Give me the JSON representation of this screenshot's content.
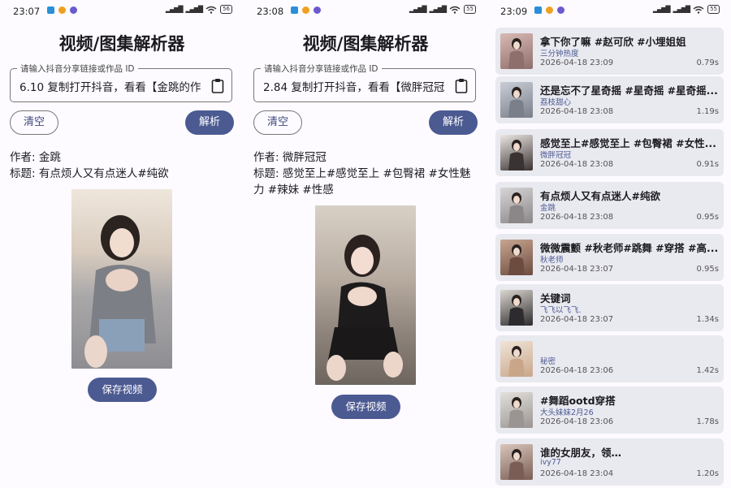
{
  "screen1": {
    "status_time": "23:07",
    "status_signal": "⁵⁶ᴵᴵˡ",
    "status_battery": "56",
    "title": "视频/图集解析器",
    "input_label": "请输入抖音分享链接或作品 ID",
    "input_value": "6.10 复制打开抖音，看看【金跳的作",
    "clear_label": "清空",
    "parse_label": "解析",
    "author": "作者: 金跳",
    "caption": "标题: 有点烦人又有点迷人#纯欲",
    "save_label": "保存视频"
  },
  "screen2": {
    "status_time": "23:08",
    "status_battery": "55",
    "title": "视频/图集解析器",
    "input_label": "请输入抖音分享链接或作品 ID",
    "input_value": "2.84 复制打开抖音，看看【微胖冠冠",
    "clear_label": "清空",
    "parse_label": "解析",
    "author": "作者: 微胖冠冠",
    "caption": "标题: 感觉至上#感觉至上 #包臀裙 #女性魅力 #辣妹 #性感",
    "save_label": "保存视频"
  },
  "screen3": {
    "status_time": "23:09",
    "status_battery": "55",
    "items": [
      {
        "title": "拿下你了嘛 #赵可欣 #小埋姐姐",
        "author": "三分钟热度",
        "date": "2026-04-18 23:09",
        "time": "0.79s"
      },
      {
        "title": "还是忘不了星奇摇 #星奇摇 #星奇摇...",
        "author": "荔枝甜心",
        "date": "2026-04-18 23:08",
        "time": "1.19s"
      },
      {
        "title": "感觉至上#感觉至上 #包臀裙 #女性...",
        "author": "微胖冠冠",
        "date": "2026-04-18 23:08",
        "time": "0.91s"
      },
      {
        "title": "有点烦人又有点迷人#纯欲",
        "author": "金跳",
        "date": "2026-04-18 23:08",
        "time": "0.95s"
      },
      {
        "title": "微微震颤 #秋老师#跳舞 #穿搭 #高...",
        "author": "秋老师",
        "date": "2026-04-18 23:07",
        "time": "0.95s"
      },
      {
        "title": "关键词",
        "author": "飞飞以飞飞.",
        "date": "2026-04-18 23:07",
        "time": "1.34s"
      },
      {
        "title": "",
        "author": "秘密",
        "date": "2026-04-18 23:06",
        "time": "1.42s"
      },
      {
        "title": "#舞蹈ootd穿搭",
        "author": "大头妹妹2月26",
        "date": "2026-04-18 23:06",
        "time": "1.78s"
      },
      {
        "title": "谁的女朋友，领…",
        "author": "ivy77",
        "date": "2026-04-18 23:04",
        "time": "1.20s"
      }
    ]
  },
  "colors": {
    "primary": "#4c5a92",
    "background": "#fdfbff",
    "card": "#e9e9f0"
  },
  "icons": {
    "paste": "clipboard-icon",
    "wifi": "wifi-icon",
    "signal": "signal-icon",
    "battery": "battery-icon"
  }
}
